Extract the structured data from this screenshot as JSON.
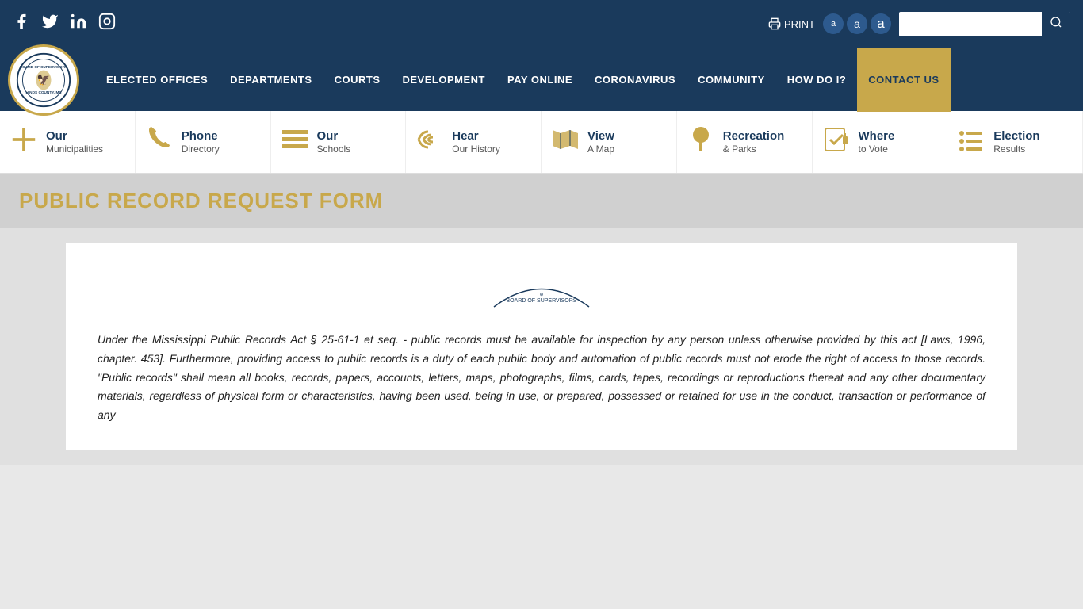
{
  "social": {
    "facebook": "f",
    "twitter": "t",
    "linkedin": "in",
    "instagram": "ig"
  },
  "topbar": {
    "print_label": "PRINT",
    "font_a_small": "a",
    "font_a_medium": "a",
    "font_a_large": "a",
    "search_placeholder": ""
  },
  "logo": {
    "seal_text": "BOARD OF SUPERVISORS\nHINDS COUNTY, MS"
  },
  "nav": {
    "items": [
      {
        "label": "ELECTED OFFICES",
        "id": "elected-offices"
      },
      {
        "label": "DEPARTMENTS",
        "id": "departments"
      },
      {
        "label": "COURTS",
        "id": "courts"
      },
      {
        "label": "DEVELOPMENT",
        "id": "development"
      },
      {
        "label": "PAY ONLINE",
        "id": "pay-online"
      },
      {
        "label": "CORONAVIRUS",
        "id": "coronavirus"
      },
      {
        "label": "COMMUNITY",
        "id": "community"
      },
      {
        "label": "HOW DO I?",
        "id": "how-do-i"
      },
      {
        "label": "CONTACT US",
        "id": "contact-us",
        "highlight": true
      }
    ]
  },
  "quick_links": [
    {
      "id": "municipalities",
      "main": "Our",
      "sub": "Municipalities",
      "icon": "cross"
    },
    {
      "id": "phone",
      "main": "Phone",
      "sub": "Directory",
      "icon": "phone"
    },
    {
      "id": "schools",
      "main": "Our",
      "sub": "Schools",
      "icon": "lines"
    },
    {
      "id": "hear",
      "main": "Hear",
      "sub": "Our History",
      "icon": "signal"
    },
    {
      "id": "map",
      "main": "View",
      "sub": "A Map",
      "icon": "map"
    },
    {
      "id": "recreation",
      "main": "Recreation",
      "sub": "& Parks",
      "icon": "tree"
    },
    {
      "id": "vote",
      "main": "Where",
      "sub": "to Vote",
      "icon": "ballot"
    },
    {
      "id": "election",
      "main": "Election",
      "sub": "Results",
      "icon": "list"
    }
  ],
  "page": {
    "title": "PUBLIC RECORD REQUEST FORM"
  },
  "form_text": "Under the Mississippi Public Records Act § 25-61-1 et seq.  - public records must be available for inspection by any person unless otherwise provided by this act [Laws, 1996, chapter. 453]. Furthermore, providing access to public records is a duty of each public body and automation of public records must not erode the right of access to those records. \"Public records\" shall mean all books, records, papers, accounts, letters, maps, photographs, films, cards, tapes, recordings or reproductions thereat and  any other documentary materials, regardless of physical form or characteristics, having been used, being in use, or prepared, possessed or retained for use in the conduct, transaction or performance of any"
}
